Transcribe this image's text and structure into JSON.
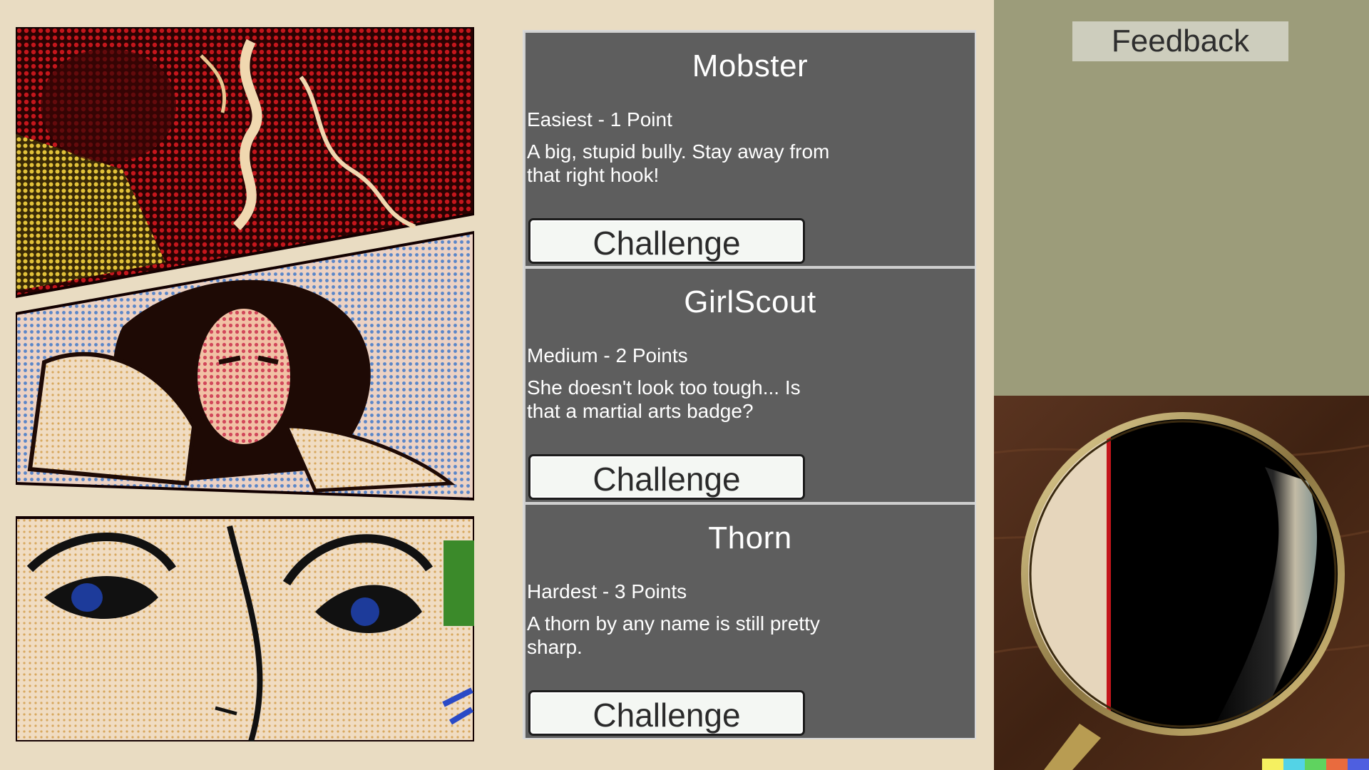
{
  "feedback": {
    "label": "Feedback"
  },
  "opponents": [
    {
      "name": "Mobster",
      "difficulty": "Easiest - 1 Point",
      "description": "A big, stupid bully.  Stay away from that right hook!",
      "button": "Challenge"
    },
    {
      "name": "GirlScout",
      "difficulty": "Medium - 2 Points",
      "description": "She doesn't look too tough...  Is that a martial arts badge?",
      "button": "Challenge"
    },
    {
      "name": "Thorn",
      "difficulty": "Hardest - 3 Points",
      "description": "A thorn by any name is still pretty sharp.",
      "button": "Challenge"
    }
  ],
  "colors": {
    "background": "#e9dcc2",
    "card_bg": "#5e5e5e",
    "panel_olive": "#9c9c7a",
    "wood": "#4b2a17",
    "strip": [
      "#f5f060",
      "#53d3e6",
      "#5fd35f",
      "#e96b3e",
      "#4e5fe0"
    ]
  },
  "icons": {
    "art": "comic-panels-illustration",
    "lens": "magnifying-glass-icon"
  }
}
